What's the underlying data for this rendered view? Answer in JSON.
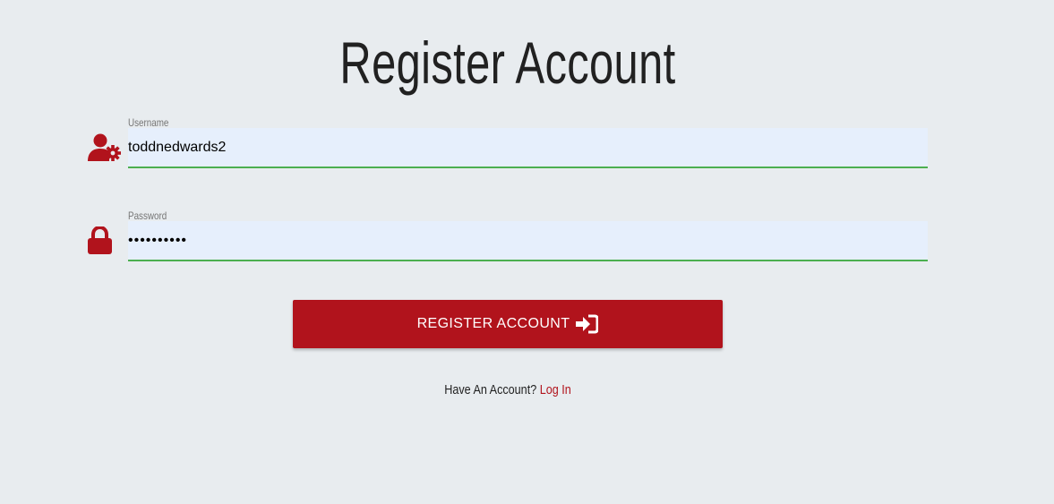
{
  "page": {
    "title": "Register Account"
  },
  "form": {
    "username": {
      "label": "Username",
      "value": "toddnedwards2",
      "icon": "user-gear-icon"
    },
    "password": {
      "label": "Password",
      "value": "••••••••••",
      "icon": "lock-icon"
    },
    "submit": {
      "label": "REGISTER ACCOUNT",
      "icon": "sign-in-icon"
    }
  },
  "footer": {
    "prompt": "Have An Account?",
    "link_label": "Log In"
  },
  "colors": {
    "accent": "#b1131c",
    "background": "#e8ecef",
    "input_bg": "#e6effc",
    "valid_underline": "#4caf50"
  }
}
